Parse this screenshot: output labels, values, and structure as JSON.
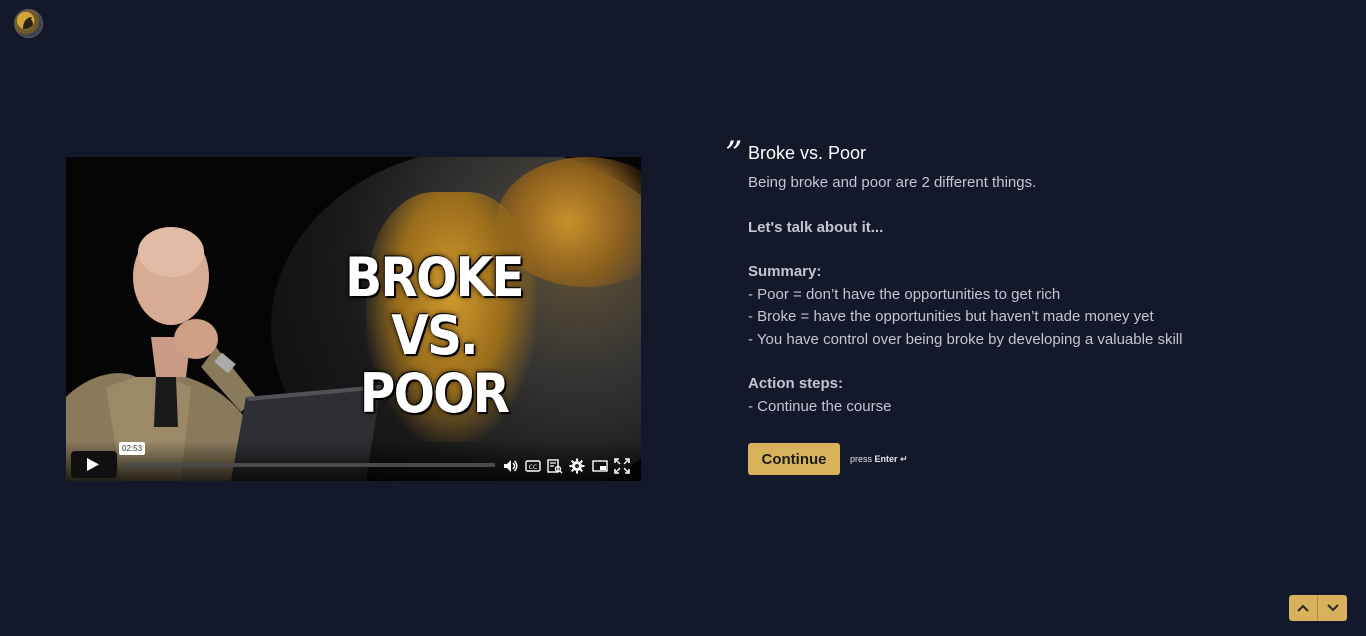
{
  "logo": {
    "icon": "brand-logo-icon"
  },
  "video": {
    "thumbnail_title": "BROKE VS. POOR",
    "current_time": "02:53",
    "controls": {
      "play": "play-icon",
      "volume": "volume-icon",
      "captions": "captions-icon",
      "chapters": "chapters-icon",
      "settings": "settings-icon",
      "pip": "picture-in-picture-icon",
      "fullscreen": "fullscreen-icon"
    }
  },
  "lesson": {
    "quote_mark": "”",
    "title": "Broke vs. Poor",
    "intro": "Being broke and poor are 2 different things.",
    "lets_talk": "Let's talk about it...",
    "summary_heading": "Summary:",
    "summary_items": [
      "- Poor = don’t have the opportunities to get rich",
      "- Broke = have the opportunities but haven’t made money yet",
      "- You have control over being broke by developing a valuable skill"
    ],
    "action_heading": "Action steps:",
    "action_items": [
      "- Continue the course"
    ],
    "continue_label": "Continue",
    "press_text": "press",
    "enter_text": "Enter ↵"
  },
  "nav": {
    "up_icon": "chevron-up-icon",
    "down_icon": "chevron-down-icon"
  },
  "colors": {
    "background": "#13182a",
    "accent": "#d8b25a"
  }
}
